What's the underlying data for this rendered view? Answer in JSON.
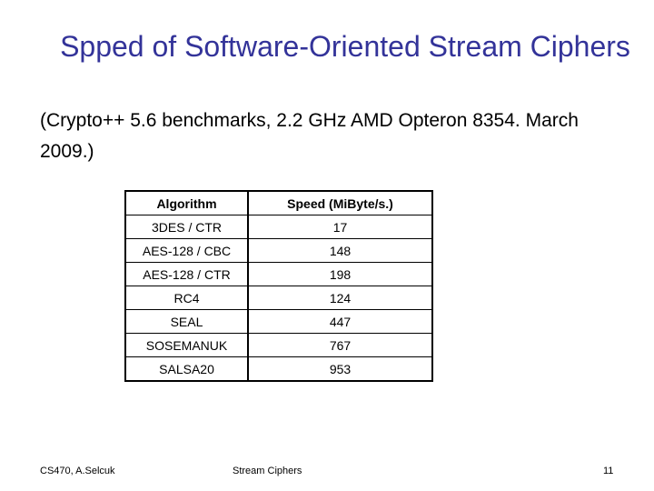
{
  "slide": {
    "title": "Spped of Software-Oriented Stream Ciphers",
    "subtitle": "(Crypto++ 5.6 benchmarks, 2.2 GHz AMD Opteron 8354. March 2009.)",
    "title_color": "#333399"
  },
  "table": {
    "headers": [
      "Algorithm",
      "Speed  (MiByte/s.)"
    ],
    "rows": [
      {
        "algorithm": "3DES / CTR",
        "speed": "17"
      },
      {
        "algorithm": "AES-128 / CBC",
        "speed": "148"
      },
      {
        "algorithm": "AES-128 / CTR",
        "speed": "198"
      },
      {
        "algorithm": "RC4",
        "speed": "124"
      },
      {
        "algorithm": "SEAL",
        "speed": "447"
      },
      {
        "algorithm": "SOSEMANUK",
        "speed": "767"
      },
      {
        "algorithm": "SALSA20",
        "speed": "953"
      }
    ]
  },
  "footer": {
    "left": "CS470, A.Selcuk",
    "center": "Stream Ciphers",
    "page_number": "11"
  }
}
